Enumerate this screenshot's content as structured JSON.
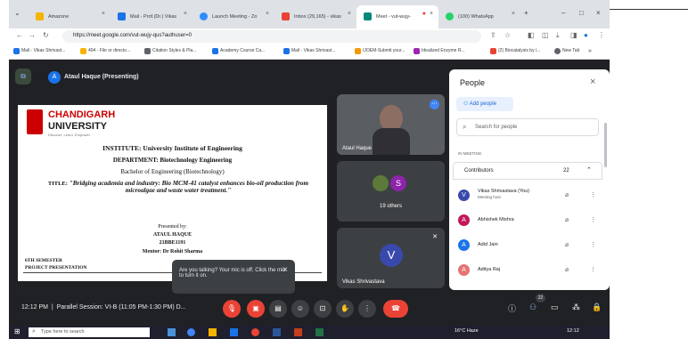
{
  "tabs": [
    {
      "label": "Amazone",
      "color": "#f4b400"
    },
    {
      "label": "Mail - Prof.(Dr.) Vikas",
      "color": "#1a73e8"
    },
    {
      "label": "Launch Meeting - Zo",
      "color": "#2d8cff"
    },
    {
      "label": "Inbox (29,165) - vikas",
      "color": "#ea4335"
    },
    {
      "label": "Meet - vut-wujy-",
      "color": "#00897b"
    },
    {
      "label": "(100) WhatsApp",
      "color": "#25d366"
    }
  ],
  "address": {
    "url": "https://meet.google.com/vut-wujy-qus?authuser=0"
  },
  "bookmarks": [
    {
      "label": "Mail - Vikas Shrivast...",
      "color": "#1a73e8"
    },
    {
      "label": "404 - File or directo...",
      "color": "#f4b400"
    },
    {
      "label": "Citation Styles & Pla...",
      "color": "#5f6368"
    },
    {
      "label": "Academy Course Ca...",
      "color": "#1a73e8"
    },
    {
      "label": "Mail - Vikas Shrivast...",
      "color": "#1a73e8"
    },
    {
      "label": "IJOEM-Submit your...",
      "color": "#f29900"
    },
    {
      "label": "Idealized Enzyme R...",
      "color": "#9c27b0"
    },
    {
      "label": "(2) Biocatalysis by i...",
      "color": "#ea4335"
    },
    {
      "label": "New Tab",
      "color": "#5f6368"
    }
  ],
  "meet": {
    "presenter_initial": "A",
    "presenting_label": "Ataul Haque (Presenting)"
  },
  "slide": {
    "university_line1": "CHANDIGARH",
    "university_line2": "UNIVERSITY",
    "tagline": "Discover. Learn. Empower.",
    "institute": "INSTITUTE: University Institute of Engineering",
    "department": "DEPARTMENT: Biotechnology Engineering",
    "degree": "Bachelor of Engineering (Biotechnology)",
    "title_label": "TITLE:",
    "title": "\"Bridging academia and industry: Bio MCM-41 catalyst enhances bio-oil production from microalgae and waste water treatment.\"",
    "presented_by": "Presented by:",
    "presenter": "ATAUL HAQUE",
    "roll": "21BBE1191",
    "mentor": "Mentor: Dr Rohit Sharma",
    "semester": "6TH SEMESTER",
    "project": "PROJECT PRESENTATION"
  },
  "tiles": [
    {
      "label": "Ataul Haque"
    },
    {
      "label": "19 others",
      "initial": "S"
    },
    {
      "label": "Vikas Shrivastava",
      "initial": "V"
    }
  ],
  "people": {
    "title": "People",
    "add": "Add people",
    "search_placeholder": "Search for people",
    "in_meeting": "IN MEETING",
    "contributors": "Contributors",
    "count": "22",
    "list": [
      {
        "name": "Vikas Shrivastava (You)",
        "sub": "Meeting host",
        "initial": "V",
        "color": "#3949ab"
      },
      {
        "name": "Abhishek Mishra",
        "sub": "",
        "initial": "A",
        "color": "#c2185b"
      },
      {
        "name": "Adid Jain",
        "sub": "",
        "initial": "A",
        "color": "#1a73e8"
      },
      {
        "name": "Aditya Raj",
        "sub": "",
        "initial": "A",
        "color": "#e57373"
      }
    ]
  },
  "tooltip": {
    "text": "Are you talking? Your mic is off. Click the mic to turn it on."
  },
  "controls": {
    "time": "12:12 PM",
    "session": "Parallel Session: VI-B (11:05 PM-1:30 PM) D...",
    "people_badge": "22"
  },
  "taskbar": {
    "search_placeholder": "Type here to search",
    "weather": "16°C  Haze",
    "clock": "12:12"
  }
}
